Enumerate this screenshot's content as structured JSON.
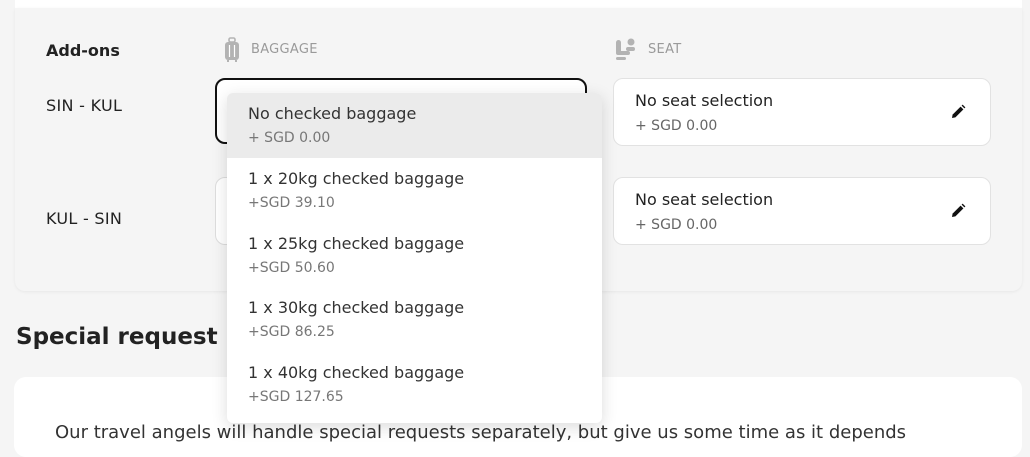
{
  "addons": {
    "title": "Add-ons",
    "baggage_header": "BAGGAGE",
    "seat_header": "SEAT"
  },
  "routes": [
    {
      "label": "SIN - KUL",
      "seat_title": "No seat selection",
      "seat_price": "+ SGD 0.00"
    },
    {
      "label": "KUL - SIN",
      "seat_title": "No seat selection",
      "seat_price": "+ SGD 0.00"
    }
  ],
  "baggage_dropdown": {
    "options": [
      {
        "name": "No checked baggage",
        "price": "+ SGD 0.00",
        "selected": true
      },
      {
        "name": "1 x 20kg checked baggage",
        "price": "+SGD 39.10"
      },
      {
        "name": "1 x 25kg checked baggage",
        "price": "+SGD 50.60"
      },
      {
        "name": "1 x 30kg checked baggage",
        "price": "+SGD 86.25"
      },
      {
        "name": "1 x 40kg checked baggage",
        "price": "+SGD 127.65"
      }
    ]
  },
  "special_request": {
    "title": "Special request",
    "text": "Our travel angels will handle special requests separately, but give us some time as it depends"
  },
  "icons": {
    "baggage": "luggage-icon",
    "seat": "seat-icon",
    "edit": "pencil-icon"
  },
  "colors": {
    "selected_option_bg": "#ebebeb",
    "focus_border": "#111111",
    "header_gray": "#9a9a9a"
  }
}
